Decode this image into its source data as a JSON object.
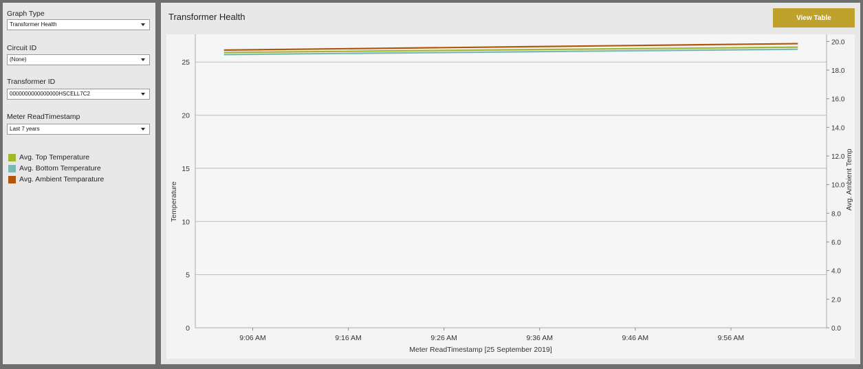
{
  "sidebar": {
    "graph_type": {
      "label": "Graph Type",
      "value": "Transformer Health"
    },
    "circuit_id": {
      "label": "Circuit ID",
      "value": "(None)"
    },
    "transformer_id": {
      "label": "Transformer ID",
      "value": "0000000000000000HSCELL7C2"
    },
    "meter_read": {
      "label": "Meter ReadTimestamp",
      "value": "Last 7 years"
    },
    "legend": [
      {
        "label": "Avg. Top Temperature",
        "color": "#a3b72c"
      },
      {
        "label": "Avg. Bottom Temperature",
        "color": "#7cb7b3"
      },
      {
        "label": "Avg. Ambient Temparature",
        "color": "#b1560f"
      }
    ]
  },
  "main": {
    "title": "Transformer Health",
    "view_table_label": "View Table"
  },
  "chart_data": {
    "type": "line",
    "xlabel": "Meter ReadTimestamp [25 September 2019]",
    "ylabel": "Temperature",
    "y2label": "Avg. Ambient Temp",
    "x_ticks": [
      "9:06 AM",
      "9:16 AM",
      "9:26 AM",
      "9:36 AM",
      "9:46 AM",
      "9:56 AM"
    ],
    "x_range_minutes": [
      0,
      66
    ],
    "ylim": [
      0,
      27.6
    ],
    "y_ticks": [
      0,
      5,
      10,
      15,
      20,
      25
    ],
    "y2lim": [
      0,
      20.5
    ],
    "y2_ticks": [
      "0.0",
      "2.0",
      "4.0",
      "6.0",
      "8.0",
      "10.0",
      "12.0",
      "14.0",
      "16.0",
      "18.0",
      "20.0"
    ],
    "grid": true,
    "series": [
      {
        "name": "Avg. Bottom Temperature",
        "axis": "left",
        "color": "#7cb7b3",
        "x": [
          3,
          63
        ],
        "y": [
          25.7,
          26.2
        ]
      },
      {
        "name": "Avg. Top Temperature",
        "axis": "left",
        "color": "#a3b72c",
        "x": [
          3,
          63
        ],
        "y": [
          25.9,
          26.4
        ]
      },
      {
        "name": "Avg. Ambient Temparature",
        "axis": "right",
        "color": "#b1560f",
        "x": [
          3,
          63
        ],
        "y": [
          19.4,
          19.85
        ]
      }
    ]
  }
}
